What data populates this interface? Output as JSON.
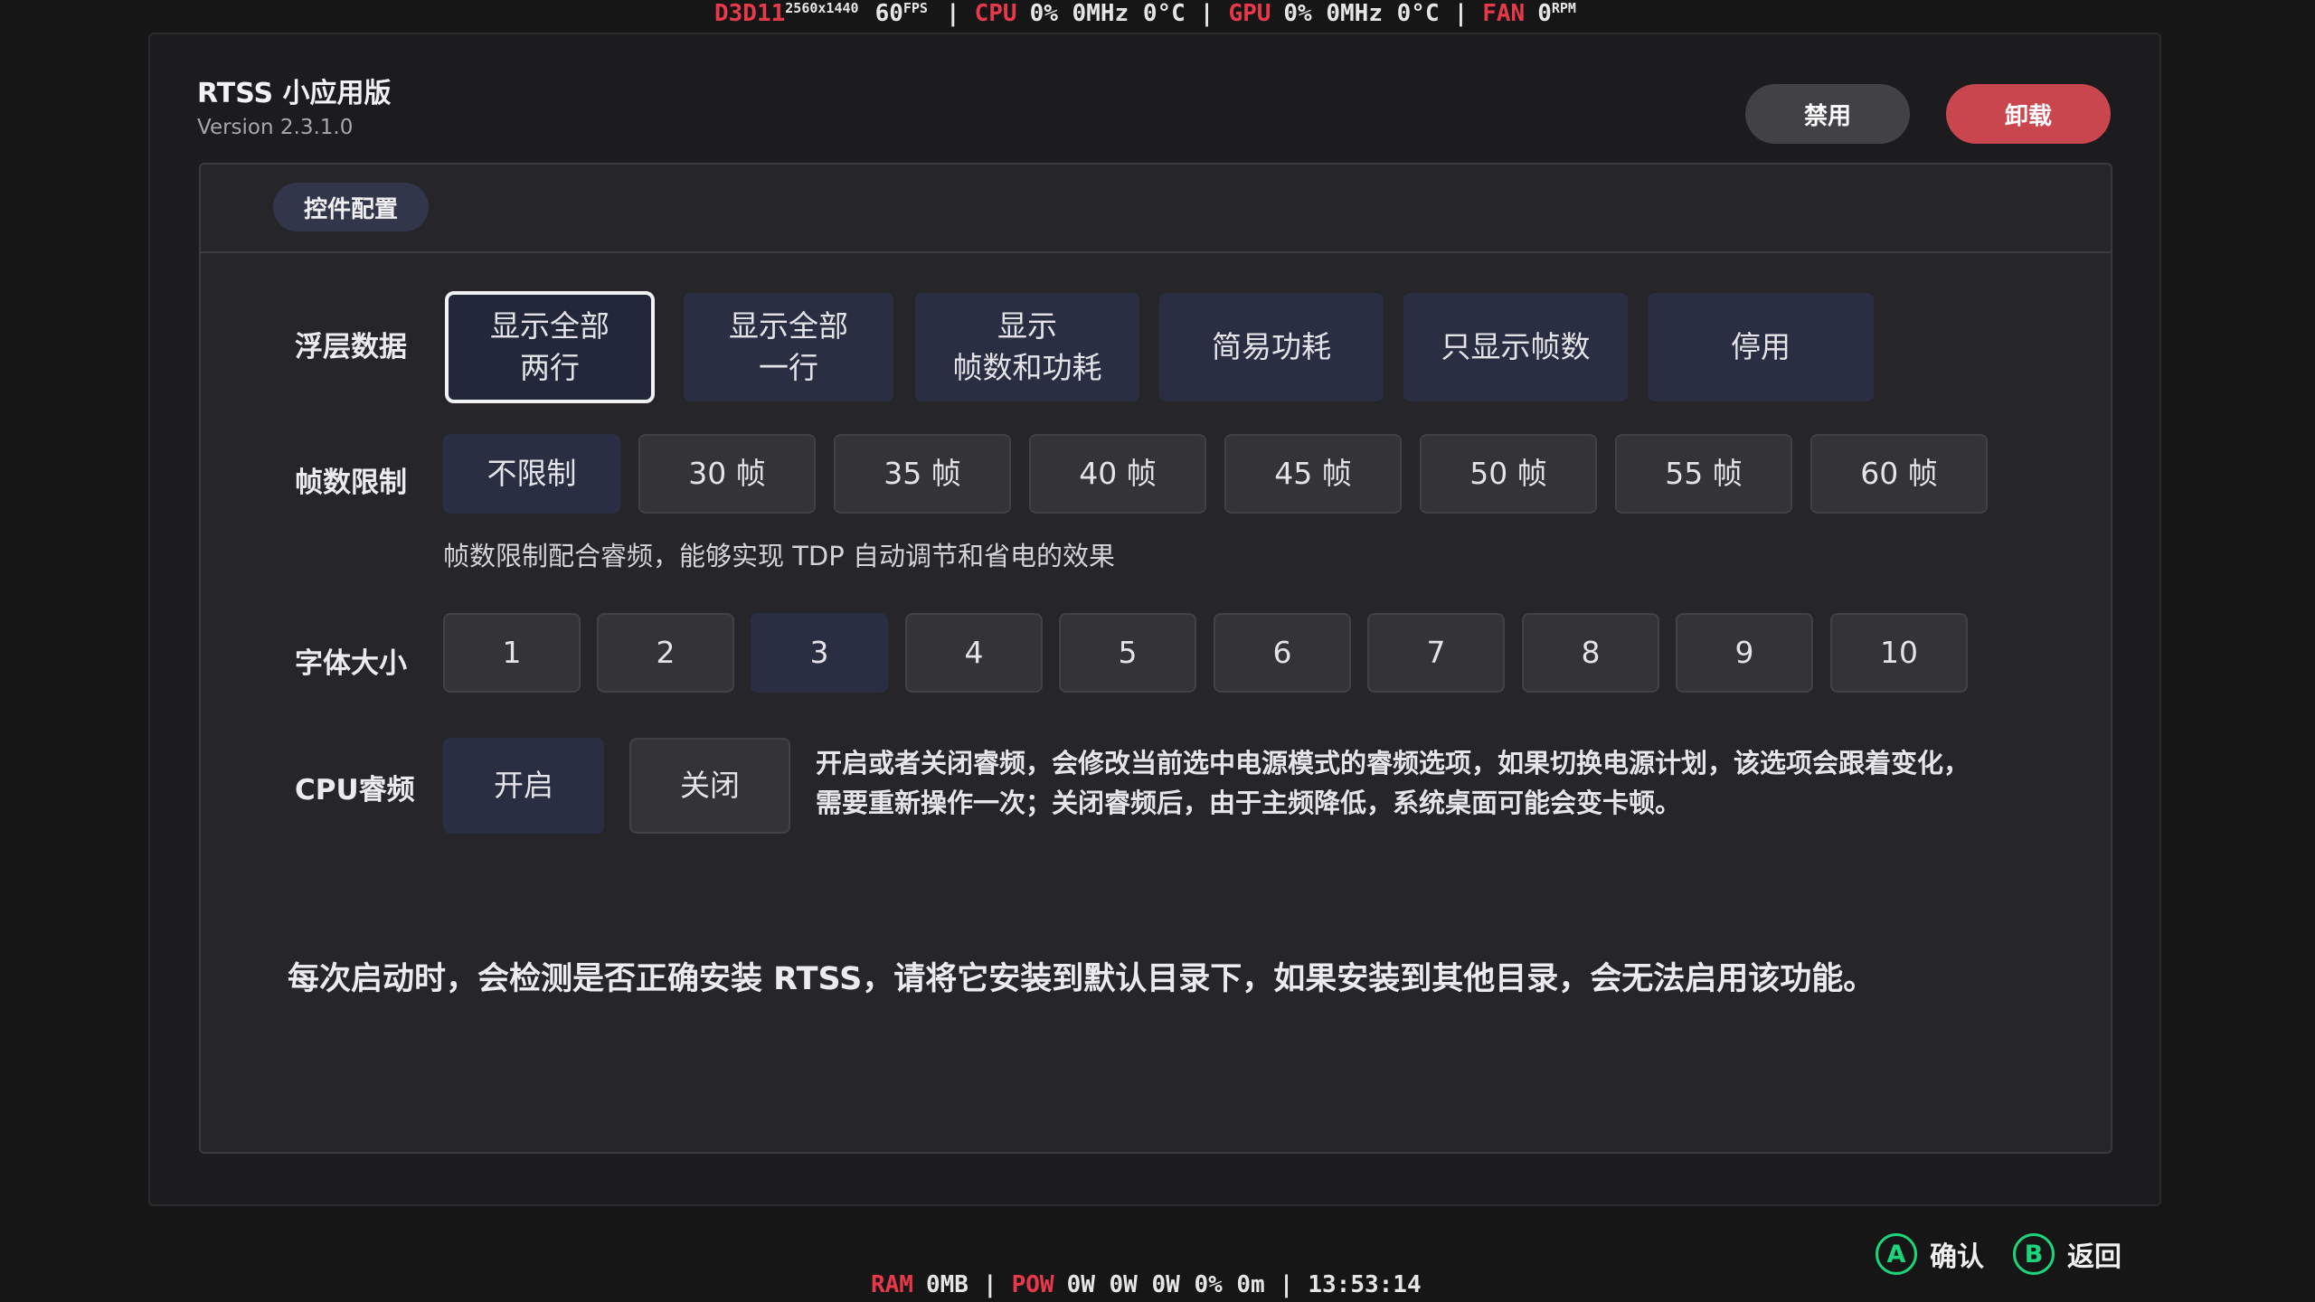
{
  "osd_top": {
    "api": "D3D11",
    "resolution": "2560x1440",
    "fps_value": "60",
    "fps_unit": "FPS",
    "cpu_label": "CPU",
    "cpu_values": "0% 0MHz 0°C",
    "gpu_label": "GPU",
    "gpu_values": "0% 0MHz 0°C",
    "fan_label": "FAN",
    "fan_value": "0",
    "fan_unit": "RPM"
  },
  "osd_bottom": {
    "ram_label": "RAM",
    "ram_value": "0MB",
    "pow_label": "POW",
    "pow_values": "0W 0W 0W 0% 0m",
    "clock": "13:53:14"
  },
  "header": {
    "title": "RTSS 小应用版",
    "version": "Version 2.3.1.0",
    "disable_label": "禁用",
    "uninstall_label": "卸载"
  },
  "panel": {
    "tab_label": "控件配置"
  },
  "overlay": {
    "label": "浮层数据",
    "options": [
      {
        "line1": "显示全部",
        "line2": "两行"
      },
      {
        "line1": "显示全部",
        "line2": "一行"
      },
      {
        "line1": "显示",
        "line2": "帧数和功耗"
      },
      {
        "line1": "简易功耗",
        "line2": ""
      },
      {
        "line1": "只显示帧数",
        "line2": ""
      },
      {
        "line1": "停用",
        "line2": ""
      }
    ]
  },
  "fps_limit": {
    "label": "帧数限制",
    "options": [
      "不限制",
      "30 帧",
      "35 帧",
      "40 帧",
      "45 帧",
      "50 帧",
      "55 帧",
      "60 帧"
    ],
    "hint": "帧数限制配合睿频，能够实现 TDP 自动调节和省电的效果"
  },
  "font_size": {
    "label": "字体大小",
    "options": [
      "1",
      "2",
      "3",
      "4",
      "5",
      "6",
      "7",
      "8",
      "9",
      "10"
    ],
    "selected": "3"
  },
  "cpu_boost": {
    "label": "CPU睿频",
    "on_label": "开启",
    "off_label": "关闭",
    "description": "开启或者关闭睿频，会修改当前选中电源模式的睿频选项，如果切换电源计划，该选项会跟着变化，需要重新操作一次；关闭睿频后，由于主频降低，系统桌面可能会变卡顿。"
  },
  "notice": "每次启动时，会检测是否正确安装 RTSS，请将它安装到默认目录下，如果安装到其他目录，会无法启用该功能。",
  "footer": {
    "a_glyph": "A",
    "confirm_label": "确认",
    "b_glyph": "B",
    "back_label": "返回"
  },
  "colors": {
    "accent_red": "#c9464f",
    "osd_red": "#e8394a",
    "controller_green": "#1ed47a",
    "selected_navy": "#2a2e42"
  }
}
